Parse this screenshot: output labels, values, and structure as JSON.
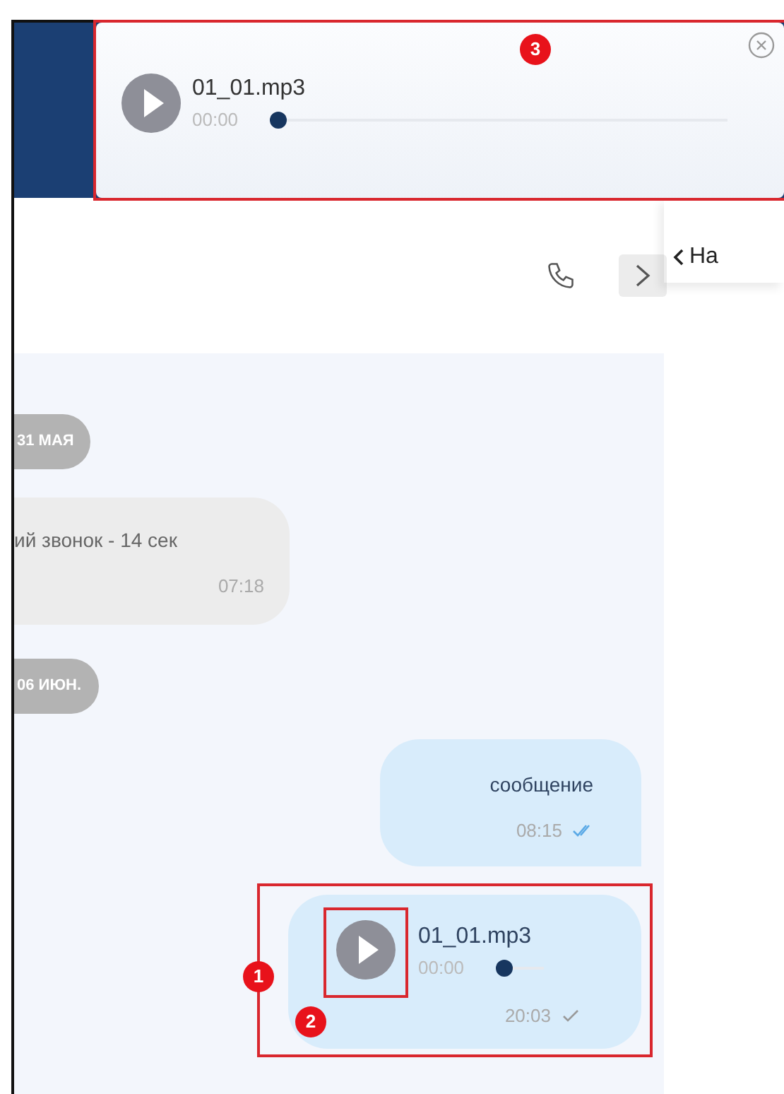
{
  "player": {
    "title": "01_01.mp3",
    "time": "00:00",
    "level": 0,
    "annotation": "3"
  },
  "side_panel": {
    "back_label": "На"
  },
  "messages": [
    {
      "kind": "date",
      "text": "31 МАЯ"
    },
    {
      "kind": "incoming",
      "text": "ий звонок - 14 сек",
      "time": "07:18"
    },
    {
      "kind": "date",
      "text": "06 ИЮН."
    },
    {
      "kind": "outgoing",
      "text": "сообщение",
      "time": "08:15",
      "read": true
    },
    {
      "kind": "audio",
      "title": "01_01.mp3",
      "elapsed": "00:00",
      "level": 0,
      "time": "20:03",
      "read": false,
      "annotation": "1",
      "play_annotation": "2"
    }
  ]
}
